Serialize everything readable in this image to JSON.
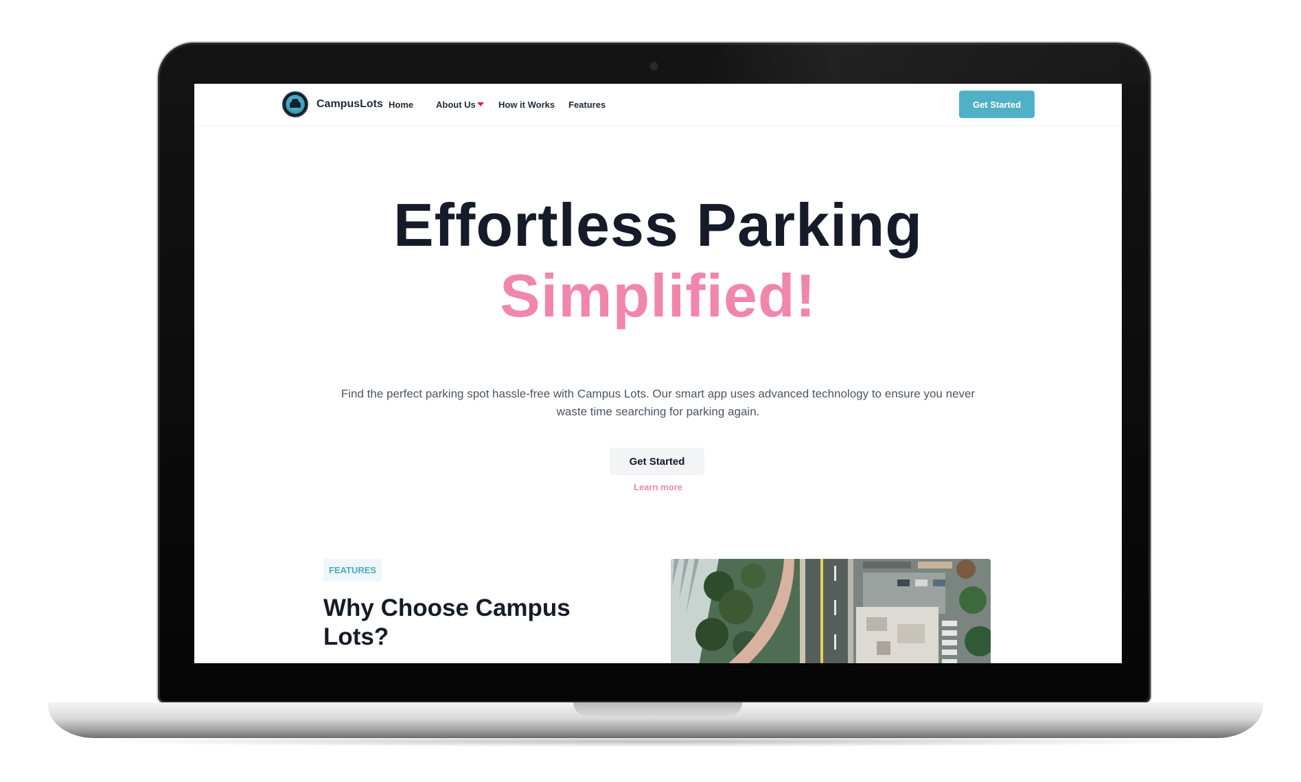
{
  "nav": {
    "brand": "CampusLots",
    "links": [
      {
        "label": "Home"
      },
      {
        "label": "About Us"
      },
      {
        "label": "How it Works"
      },
      {
        "label": "Features"
      }
    ],
    "cta": "Get Started"
  },
  "hero": {
    "title": "Effortless Parking",
    "accent": "Simplified!",
    "description": "Find the perfect parking spot hassle-free with Campus Lots. Our smart app uses advanced technology to ensure you never waste time searching for parking again.",
    "cta": "Get Started",
    "secondary": "Learn more"
  },
  "features": {
    "badge": "FEATURES",
    "title": "Why Choose Campus Lots?"
  },
  "colors": {
    "primary": "#4fb0c6",
    "accent": "#f186ad",
    "heading": "#151b28"
  },
  "icons": {
    "logo": "car-logo-icon",
    "dropdown": "caret-down-icon",
    "camera": "webcam-icon"
  }
}
